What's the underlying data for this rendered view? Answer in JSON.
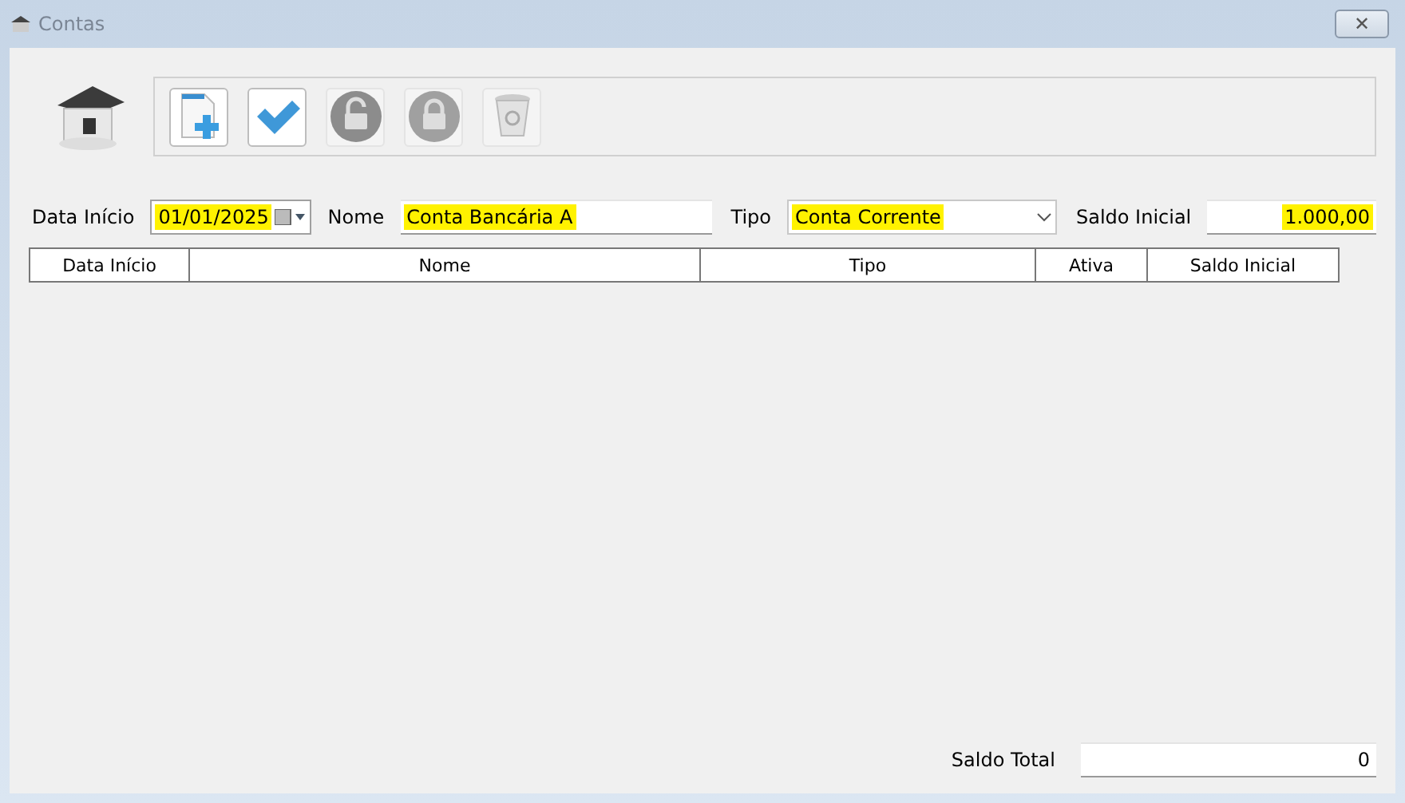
{
  "window": {
    "title": "Contas",
    "close": "✕"
  },
  "toolbar": [
    {
      "kind": "new",
      "disabled": false
    },
    {
      "kind": "confirm",
      "disabled": false
    },
    {
      "kind": "unlock",
      "disabled": true
    },
    {
      "kind": "lock",
      "disabled": true
    },
    {
      "kind": "trash",
      "disabled": true
    }
  ],
  "form": {
    "data_inicio": {
      "label": "Data Início",
      "value": "01/01/2025",
      "highlighted": true
    },
    "nome": {
      "label": "Nome",
      "value": "Conta Bancária A",
      "highlighted": true
    },
    "tipo": {
      "label": "Tipo",
      "value": "Conta Corrente",
      "highlighted": true
    },
    "saldo_inicial": {
      "label": "Saldo Inicial",
      "value": "1.000,00",
      "highlighted": true
    }
  },
  "table": {
    "columns": [
      "Data Início",
      "Nome",
      "Tipo",
      "Ativa",
      "Saldo Inicial"
    ]
  },
  "footer": {
    "label": "Saldo Total",
    "value": "0"
  }
}
